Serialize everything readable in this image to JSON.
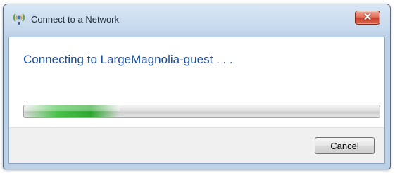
{
  "window": {
    "title": "Connect to a Network",
    "title_icon": "network-connection-icon",
    "close_icon": "close-icon",
    "close_label": "✕"
  },
  "main": {
    "message": "Connecting to LargeMagnolia-guest . . .",
    "progress": {
      "fraction": 0.27,
      "style": "indeterminate-marquee"
    }
  },
  "footer": {
    "cancel_label": "Cancel"
  },
  "colors": {
    "message_text": "#1b4e9a",
    "progress_green": "#49c14a",
    "close_red": "#c8402a"
  }
}
